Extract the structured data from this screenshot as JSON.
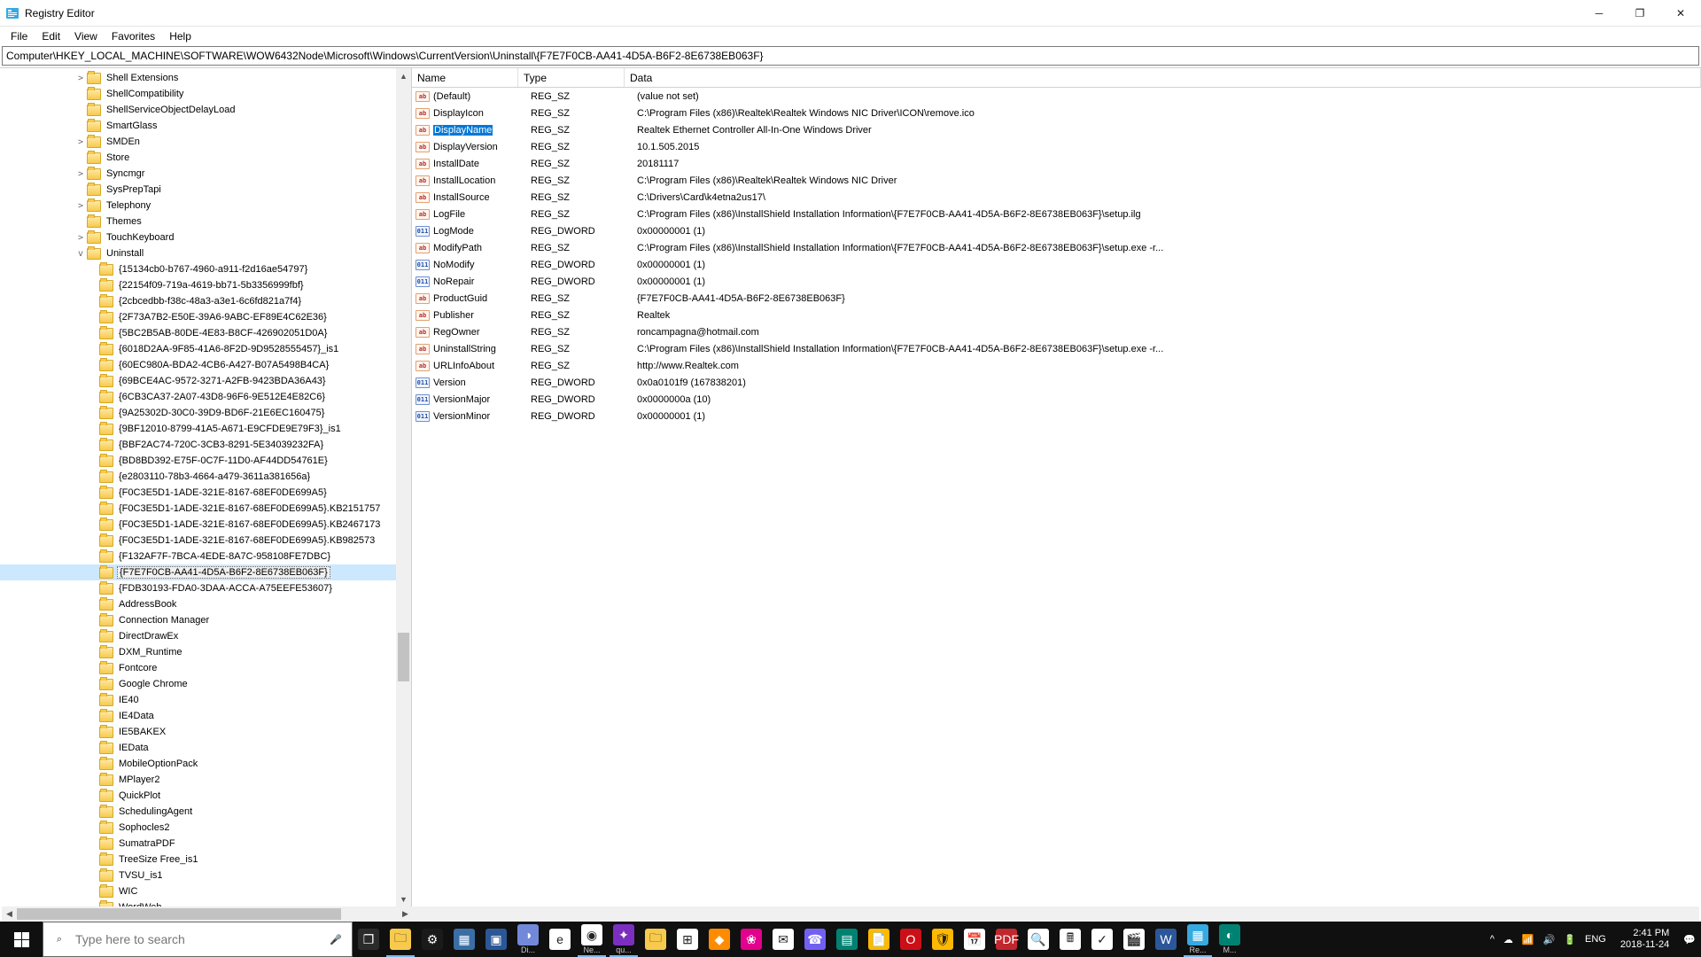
{
  "title": "Registry Editor",
  "menu": [
    "File",
    "Edit",
    "View",
    "Favorites",
    "Help"
  ],
  "address": "Computer\\HKEY_LOCAL_MACHINE\\SOFTWARE\\WOW6432Node\\Microsoft\\Windows\\CurrentVersion\\Uninstall\\{F7E7F0CB-AA41-4D5A-B6F2-8E6738EB063F}",
  "tree": [
    {
      "d": 6,
      "exp": ">",
      "label": "Shell Extensions"
    },
    {
      "d": 6,
      "exp": "",
      "label": "ShellCompatibility"
    },
    {
      "d": 6,
      "exp": "",
      "label": "ShellServiceObjectDelayLoad"
    },
    {
      "d": 6,
      "exp": "",
      "label": "SmartGlass"
    },
    {
      "d": 6,
      "exp": ">",
      "label": "SMDEn"
    },
    {
      "d": 6,
      "exp": "",
      "label": "Store"
    },
    {
      "d": 6,
      "exp": ">",
      "label": "Syncmgr"
    },
    {
      "d": 6,
      "exp": "",
      "label": "SysPrepTapi"
    },
    {
      "d": 6,
      "exp": ">",
      "label": "Telephony"
    },
    {
      "d": 6,
      "exp": "",
      "label": "Themes"
    },
    {
      "d": 6,
      "exp": ">",
      "label": "TouchKeyboard"
    },
    {
      "d": 6,
      "exp": "v",
      "label": "Uninstall"
    },
    {
      "d": 7,
      "exp": "",
      "label": "{15134cb0-b767-4960-a911-f2d16ae54797}"
    },
    {
      "d": 7,
      "exp": "",
      "label": "{22154f09-719a-4619-bb71-5b3356999fbf}"
    },
    {
      "d": 7,
      "exp": "",
      "label": "{2cbcedbb-f38c-48a3-a3e1-6c6fd821a7f4}"
    },
    {
      "d": 7,
      "exp": "",
      "label": "{2F73A7B2-E50E-39A6-9ABC-EF89E4C62E36}"
    },
    {
      "d": 7,
      "exp": "",
      "label": "{5BC2B5AB-80DE-4E83-B8CF-426902051D0A}"
    },
    {
      "d": 7,
      "exp": "",
      "label": "{6018D2AA-9F85-41A6-8F2D-9D9528555457}_is1"
    },
    {
      "d": 7,
      "exp": "",
      "label": "{60EC980A-BDA2-4CB6-A427-B07A5498B4CA}"
    },
    {
      "d": 7,
      "exp": "",
      "label": "{69BCE4AC-9572-3271-A2FB-9423BDA36A43}"
    },
    {
      "d": 7,
      "exp": "",
      "label": "{6CB3CA37-2A07-43D8-96F6-9E512E4E82C6}"
    },
    {
      "d": 7,
      "exp": "",
      "label": "{9A25302D-30C0-39D9-BD6F-21E6EC160475}"
    },
    {
      "d": 7,
      "exp": "",
      "label": "{9BF12010-8799-41A5-A671-E9CFDE9E79F3}_is1"
    },
    {
      "d": 7,
      "exp": "",
      "label": "{BBF2AC74-720C-3CB3-8291-5E34039232FA}"
    },
    {
      "d": 7,
      "exp": "",
      "label": "{BD8BD392-E75F-0C7F-11D0-AF44DD54761E}"
    },
    {
      "d": 7,
      "exp": "",
      "label": "{e2803110-78b3-4664-a479-3611a381656a}"
    },
    {
      "d": 7,
      "exp": "",
      "label": "{F0C3E5D1-1ADE-321E-8167-68EF0DE699A5}"
    },
    {
      "d": 7,
      "exp": "",
      "label": "{F0C3E5D1-1ADE-321E-8167-68EF0DE699A5}.KB2151757"
    },
    {
      "d": 7,
      "exp": "",
      "label": "{F0C3E5D1-1ADE-321E-8167-68EF0DE699A5}.KB2467173"
    },
    {
      "d": 7,
      "exp": "",
      "label": "{F0C3E5D1-1ADE-321E-8167-68EF0DE699A5}.KB982573"
    },
    {
      "d": 7,
      "exp": "",
      "label": "{F132AF7F-7BCA-4EDE-8A7C-958108FE7DBC}"
    },
    {
      "d": 7,
      "exp": "",
      "label": "{F7E7F0CB-AA41-4D5A-B6F2-8E6738EB063F}",
      "sel": true
    },
    {
      "d": 7,
      "exp": "",
      "label": "{FDB30193-FDA0-3DAA-ACCA-A75EEFE53607}"
    },
    {
      "d": 7,
      "exp": "",
      "label": "AddressBook"
    },
    {
      "d": 7,
      "exp": "",
      "label": "Connection Manager"
    },
    {
      "d": 7,
      "exp": "",
      "label": "DirectDrawEx"
    },
    {
      "d": 7,
      "exp": "",
      "label": "DXM_Runtime"
    },
    {
      "d": 7,
      "exp": "",
      "label": "Fontcore"
    },
    {
      "d": 7,
      "exp": "",
      "label": "Google Chrome"
    },
    {
      "d": 7,
      "exp": "",
      "label": "IE40"
    },
    {
      "d": 7,
      "exp": "",
      "label": "IE4Data"
    },
    {
      "d": 7,
      "exp": "",
      "label": "IE5BAKEX"
    },
    {
      "d": 7,
      "exp": "",
      "label": "IEData"
    },
    {
      "d": 7,
      "exp": "",
      "label": "MobileOptionPack"
    },
    {
      "d": 7,
      "exp": "",
      "label": "MPlayer2"
    },
    {
      "d": 7,
      "exp": "",
      "label": "QuickPlot"
    },
    {
      "d": 7,
      "exp": "",
      "label": "SchedulingAgent"
    },
    {
      "d": 7,
      "exp": "",
      "label": "Sophocles2"
    },
    {
      "d": 7,
      "exp": "",
      "label": "SumatraPDF"
    },
    {
      "d": 7,
      "exp": "",
      "label": "TreeSize Free_is1"
    },
    {
      "d": 7,
      "exp": "",
      "label": "TVSU_is1"
    },
    {
      "d": 7,
      "exp": "",
      "label": "WIC"
    },
    {
      "d": 7,
      "exp": "",
      "label": "WordWeb"
    }
  ],
  "list_headers": {
    "name": "Name",
    "type": "Type",
    "data": "Data"
  },
  "values": [
    {
      "icon": "str",
      "name": "(Default)",
      "type": "REG_SZ",
      "data": "(value not set)"
    },
    {
      "icon": "str",
      "name": "DisplayIcon",
      "type": "REG_SZ",
      "data": "C:\\Program Files (x86)\\Realtek\\Realtek Windows NIC Driver\\ICON\\remove.ico"
    },
    {
      "icon": "str",
      "name": "DisplayName",
      "type": "REG_SZ",
      "data": "Realtek Ethernet Controller All-In-One Windows Driver",
      "sel": true
    },
    {
      "icon": "str",
      "name": "DisplayVersion",
      "type": "REG_SZ",
      "data": "10.1.505.2015"
    },
    {
      "icon": "str",
      "name": "InstallDate",
      "type": "REG_SZ",
      "data": "20181117"
    },
    {
      "icon": "str",
      "name": "InstallLocation",
      "type": "REG_SZ",
      "data": "C:\\Program Files (x86)\\Realtek\\Realtek Windows NIC Driver"
    },
    {
      "icon": "str",
      "name": "InstallSource",
      "type": "REG_SZ",
      "data": "C:\\Drivers\\Card\\k4etna2us17\\"
    },
    {
      "icon": "str",
      "name": "LogFile",
      "type": "REG_SZ",
      "data": "C:\\Program Files (x86)\\InstallShield Installation Information\\{F7E7F0CB-AA41-4D5A-B6F2-8E6738EB063F}\\setup.ilg"
    },
    {
      "icon": "bin",
      "name": "LogMode",
      "type": "REG_DWORD",
      "data": "0x00000001 (1)"
    },
    {
      "icon": "str",
      "name": "ModifyPath",
      "type": "REG_SZ",
      "data": "C:\\Program Files (x86)\\InstallShield Installation Information\\{F7E7F0CB-AA41-4D5A-B6F2-8E6738EB063F}\\setup.exe -r..."
    },
    {
      "icon": "bin",
      "name": "NoModify",
      "type": "REG_DWORD",
      "data": "0x00000001 (1)"
    },
    {
      "icon": "bin",
      "name": "NoRepair",
      "type": "REG_DWORD",
      "data": "0x00000001 (1)"
    },
    {
      "icon": "str",
      "name": "ProductGuid",
      "type": "REG_SZ",
      "data": "{F7E7F0CB-AA41-4D5A-B6F2-8E6738EB063F}"
    },
    {
      "icon": "str",
      "name": "Publisher",
      "type": "REG_SZ",
      "data": "Realtek"
    },
    {
      "icon": "str",
      "name": "RegOwner",
      "type": "REG_SZ",
      "data": "roncampagna@hotmail.com"
    },
    {
      "icon": "str",
      "name": "UninstallString",
      "type": "REG_SZ",
      "data": "C:\\Program Files (x86)\\InstallShield Installation Information\\{F7E7F0CB-AA41-4D5A-B6F2-8E6738EB063F}\\setup.exe -r..."
    },
    {
      "icon": "str",
      "name": "URLInfoAbout",
      "type": "REG_SZ",
      "data": "http://www.Realtek.com"
    },
    {
      "icon": "bin",
      "name": "Version",
      "type": "REG_DWORD",
      "data": "0x0a0101f9 (167838201)"
    },
    {
      "icon": "bin",
      "name": "VersionMajor",
      "type": "REG_DWORD",
      "data": "0x0000000a (10)"
    },
    {
      "icon": "bin",
      "name": "VersionMinor",
      "type": "REG_DWORD",
      "data": "0x00000001 (1)"
    }
  ],
  "taskbar": {
    "search_placeholder": "Type here to search",
    "items": [
      {
        "name": "task-view",
        "bg": "#2b2b2b",
        "glyph": "❐"
      },
      {
        "name": "file-explorer",
        "bg": "#f7ca4d",
        "glyph": "🗀",
        "active": true
      },
      {
        "name": "settings",
        "bg": "#1a1a1a",
        "glyph": "⚙"
      },
      {
        "name": "app-generic-1",
        "bg": "#3a6ea5",
        "glyph": "▦"
      },
      {
        "name": "app-generic-2",
        "bg": "#2b5797",
        "glyph": "▣"
      },
      {
        "name": "discord",
        "bg": "#7289da",
        "glyph": "◑",
        "lbl": "Di..."
      },
      {
        "name": "edge",
        "bg": "#ffffff",
        "glyph": "e"
      },
      {
        "name": "chrome",
        "bg": "#ffffff",
        "glyph": "◉",
        "lbl": "Ne...",
        "active": true
      },
      {
        "name": "app-purple",
        "bg": "#7b2fbf",
        "glyph": "✦",
        "lbl": "qu...",
        "active": true
      },
      {
        "name": "files",
        "bg": "#f7ca4d",
        "glyph": "🗀"
      },
      {
        "name": "store",
        "bg": "#ffffff",
        "glyph": "⊞"
      },
      {
        "name": "app-orange",
        "bg": "#ff8c00",
        "glyph": "◆"
      },
      {
        "name": "app-pink",
        "bg": "#e3008c",
        "glyph": "❀"
      },
      {
        "name": "mail",
        "bg": "#ffffff",
        "glyph": "✉"
      },
      {
        "name": "viber",
        "bg": "#7360f2",
        "glyph": "☎"
      },
      {
        "name": "app-teal",
        "bg": "#008272",
        "glyph": "▤"
      },
      {
        "name": "notes",
        "bg": "#ffb900",
        "glyph": "📄"
      },
      {
        "name": "opera",
        "bg": "#cc0f16",
        "glyph": "O"
      },
      {
        "name": "security",
        "bg": "#ffb900",
        "glyph": "🛡"
      },
      {
        "name": "calendar",
        "bg": "#ffffff",
        "glyph": "📅"
      },
      {
        "name": "pdf",
        "bg": "#c1272d",
        "glyph": "PDF"
      },
      {
        "name": "magnify",
        "bg": "#ffffff",
        "glyph": "🔍"
      },
      {
        "name": "calculator",
        "bg": "#ffffff",
        "glyph": "🖩"
      },
      {
        "name": "todo",
        "bg": "#ffffff",
        "glyph": "✓"
      },
      {
        "name": "movie",
        "bg": "#ffffff",
        "glyph": "🎬"
      },
      {
        "name": "word",
        "bg": "#2b579a",
        "glyph": "W"
      },
      {
        "name": "regedit",
        "bg": "#36a9e1",
        "glyph": "▦",
        "lbl": "Re...",
        "active": true
      },
      {
        "name": "app-teal2",
        "bg": "#008272",
        "glyph": "◐",
        "lbl": "M..."
      }
    ],
    "tray": [
      "^",
      "☁",
      "📶",
      "🔊",
      "🔋"
    ],
    "lang": "ENG",
    "time": "2:41 PM",
    "date": "2018-11-24"
  }
}
